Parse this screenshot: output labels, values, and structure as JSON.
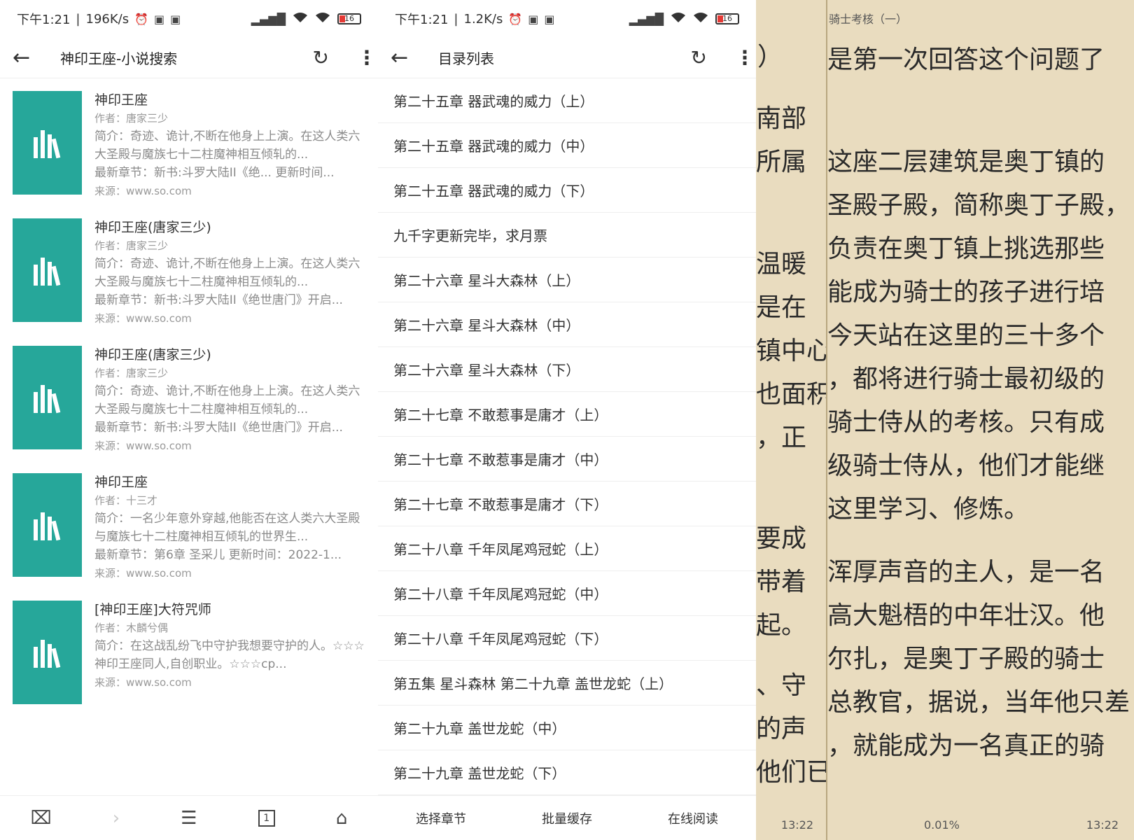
{
  "search_screen": {
    "status": {
      "time": "下午1:21",
      "speed": "196K/s",
      "battery": "16"
    },
    "title": "神印王座-小说搜索",
    "results": [
      {
        "title": "神印王座",
        "author": "作者：唐家三少",
        "desc": "简介：奇迹、诡计,不断在他身上上演。在这人类六大圣殿与魔族七十二柱魔神相互倾轧的...",
        "latest": "最新章节：新书:斗罗大陆II《绝... 更新时间...",
        "source": "来源：www.so.com"
      },
      {
        "title": "神印王座(唐家三少)",
        "author": "作者：唐家三少",
        "desc": "简介：奇迹、诡计,不断在他身上上演。在这人类六大圣殿与魔族七十二柱魔神相互倾轧的...",
        "latest": "最新章节：新书:斗罗大陆II《绝世唐门》开启...",
        "source": "来源：www.so.com"
      },
      {
        "title": "神印王座(唐家三少)",
        "author": "作者：唐家三少",
        "desc": "简介：奇迹、诡计,不断在他身上上演。在这人类六大圣殿与魔族七十二柱魔神相互倾轧的...",
        "latest": "最新章节：新书:斗罗大陆II《绝世唐门》开启...",
        "source": "来源：www.so.com"
      },
      {
        "title": "神印王座",
        "author": "作者：十三才",
        "desc": "简介：一名少年意外穿越,他能否在这人类六大圣殿与魔族七十二柱魔神相互倾轧的世界生...",
        "latest": "最新章节：第6章 圣采儿 更新时间：2022-1...",
        "source": "来源：www.so.com"
      },
      {
        "title": "[神印王座]大符咒师",
        "author": "作者：木麟兮偶",
        "desc": "简介：在这战乱纷飞中守护我想要守护的人。☆☆☆神印王座同人,自创职业。☆☆☆cp...",
        "latest": "",
        "source": "来源：www.so.com"
      }
    ],
    "bottom_nav": {
      "tab_count": "1"
    }
  },
  "toc_screen": {
    "status": {
      "time": "下午1:21",
      "speed": "1.2K/s",
      "battery": "16"
    },
    "title": "目录列表",
    "chapters": [
      "第二十五章 器武魂的威力（上）",
      "第二十五章 器武魂的威力（中）",
      "第二十五章 器武魂的威力（下）",
      "九千字更新完毕，求月票",
      "第二十六章 星斗大森林（上）",
      "第二十六章 星斗大森林（中）",
      "第二十六章 星斗大森林（下）",
      "第二十七章 不敢惹事是庸才（上）",
      "第二十七章 不敢惹事是庸才（中）",
      "第二十七章 不敢惹事是庸才（下）",
      "第二十八章 千年凤尾鸡冠蛇（上）",
      "第二十八章 千年凤尾鸡冠蛇（中）",
      "第二十八章 千年凤尾鸡冠蛇（下）",
      "第五集 星斗森林 第二十九章 盖世龙蛇（上）",
      "第二十九章 盖世龙蛇（中）",
      "第二十九章 盖世龙蛇（下）"
    ],
    "actions": {
      "select": "选择章节",
      "cache": "批量缓存",
      "read": "在线阅读"
    }
  },
  "reader_left": {
    "lines": [
      "）",
      "南部",
      "所属",
      "温暖",
      "是在",
      "镇中心",
      "也面积",
      "，正",
      "要成",
      "带着",
      "起。",
      "、守",
      "的声",
      "他们已"
    ],
    "footer_time": "13:22"
  },
  "reader_right": {
    "header": "骑士考核（一）",
    "lines": [
      "是第一次回答这个问题了",
      "这座二层建筑是奥丁镇的",
      "圣殿子殿，简称奥丁子殿，",
      "负责在奥丁镇上挑选那些",
      "能成为骑士的孩子进行培",
      "今天站在这里的三十多个",
      "，都将进行骑士最初级的",
      "骑士侍从的考核。只有成",
      "级骑士侍从，他们才能继",
      "这里学习、修炼。",
      "浑厚声音的主人，是一名",
      "高大魁梧的中年壮汉。他",
      "尔扎，是奥丁子殿的骑士",
      "总教官，据说，当年他只差",
      "，就能成为一名真正的骑"
    ],
    "progress": "0.01%",
    "footer_time": "13:22"
  }
}
